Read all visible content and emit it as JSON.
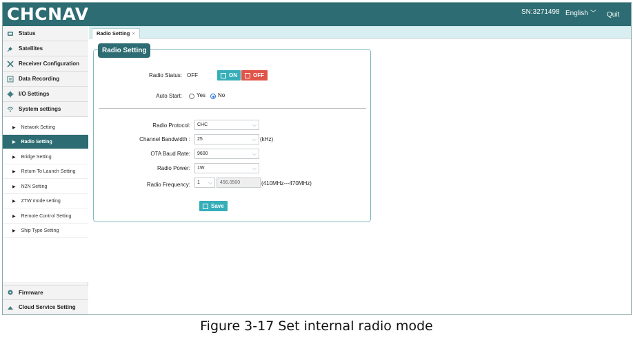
{
  "header": {
    "logo": "CHCNAV",
    "sn": "SN:3271498",
    "language": "English",
    "quit": "Quit"
  },
  "sidebar": {
    "items": [
      {
        "label": "Status",
        "icon": "status-icon"
      },
      {
        "label": "Satellites",
        "icon": "satellite-icon"
      },
      {
        "label": "Receiver Configuration",
        "icon": "tools-icon"
      },
      {
        "label": "Data Recording",
        "icon": "data-icon"
      },
      {
        "label": "I/O Settings",
        "icon": "gear-icon"
      },
      {
        "label": "System settings",
        "icon": "wifi-icon"
      }
    ],
    "sub_items": [
      "Network Setting",
      "Radio Setting",
      "Bridge Setting",
      "Return To Launch Setting",
      "N2N Setting",
      "ZTW mode setting",
      "Remote Control Setting",
      "Ship Type Setting"
    ],
    "bottom_items": [
      {
        "label": "Firmware",
        "icon": "firmware-icon"
      },
      {
        "label": "Cloud Service Setting",
        "icon": "cloud-icon"
      }
    ]
  },
  "tab": {
    "label": "Radio Setting",
    "close": "×"
  },
  "panel": {
    "title": "Radio Setting",
    "radio_status_label": "Radio Status:",
    "radio_status_value": "OFF",
    "on_button": "ON",
    "off_button": "OFF",
    "auto_start_label": "Auto Start:",
    "auto_start_yes": "Yes",
    "auto_start_no": "No",
    "radio_protocol_label": "Radio Protocol:",
    "radio_protocol_value": "CHC",
    "channel_bandwidth_label": "Channel Bandwidth :",
    "channel_bandwidth_value": "25",
    "channel_bandwidth_unit": "(kHz)",
    "ota_baud_rate_label": "OTA Baud Rate:",
    "ota_baud_rate_value": "9600",
    "radio_power_label": "Radio Power:",
    "radio_power_value": "1W",
    "radio_frequency_label": "Radio Frequency:",
    "radio_frequency_channel": "1",
    "radio_frequency_value": "456.0500",
    "radio_frequency_range": "(410MHz---470MHz)",
    "save_button": "Save"
  },
  "caption": "Figure 3-17 Set internal radio mode",
  "colors": {
    "header": "#2c6c72",
    "active": "#2c6c72",
    "on": "#35aeb9",
    "off": "#e05347"
  }
}
